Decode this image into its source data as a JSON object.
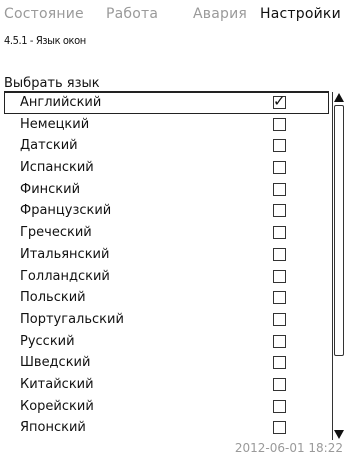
{
  "tabs": [
    {
      "label": "Состояние",
      "active": false
    },
    {
      "label": "Работа",
      "active": false
    },
    {
      "label": "Авария",
      "active": false
    },
    {
      "label": "Настройки",
      "active": true
    }
  ],
  "breadcrumb": "4.5.1 - Язык окон",
  "section_title": "Выбрать язык",
  "languages": [
    {
      "label": "Английский",
      "checked": true
    },
    {
      "label": "Немецкий",
      "checked": false
    },
    {
      "label": "Датский",
      "checked": false
    },
    {
      "label": "Испанский",
      "checked": false
    },
    {
      "label": "Финский",
      "checked": false
    },
    {
      "label": "Французский",
      "checked": false
    },
    {
      "label": "Греческий",
      "checked": false
    },
    {
      "label": "Итальянский",
      "checked": false
    },
    {
      "label": "Голландский",
      "checked": false
    },
    {
      "label": "Польский",
      "checked": false
    },
    {
      "label": "Португальский",
      "checked": false
    },
    {
      "label": "Русский",
      "checked": false
    },
    {
      "label": "Шведский",
      "checked": false
    },
    {
      "label": "Китайский",
      "checked": false
    },
    {
      "label": "Корейский",
      "checked": false
    },
    {
      "label": "Японский",
      "checked": false
    }
  ],
  "check_glyph": "✓",
  "timestamp": "2012-06-01 18:22",
  "scroll_position": 0
}
